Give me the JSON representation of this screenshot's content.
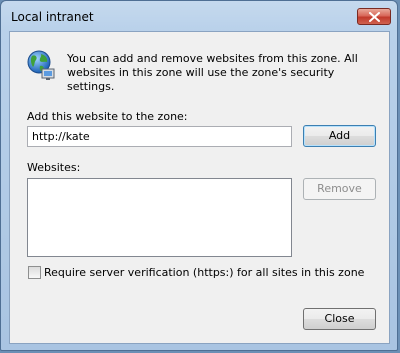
{
  "window": {
    "title": "Local intranet"
  },
  "intro_text": "You can add and remove websites from this zone. All websites in this zone will use the zone's security settings.",
  "add_section": {
    "label": "Add this website to the zone:",
    "value": "http://kate",
    "add_button": "Add"
  },
  "websites": {
    "label": "Websites:",
    "items": [],
    "remove_button": "Remove"
  },
  "require_verification": {
    "label": "Require server verification (https:) for all sites in this zone",
    "checked": false
  },
  "close_button": "Close"
}
